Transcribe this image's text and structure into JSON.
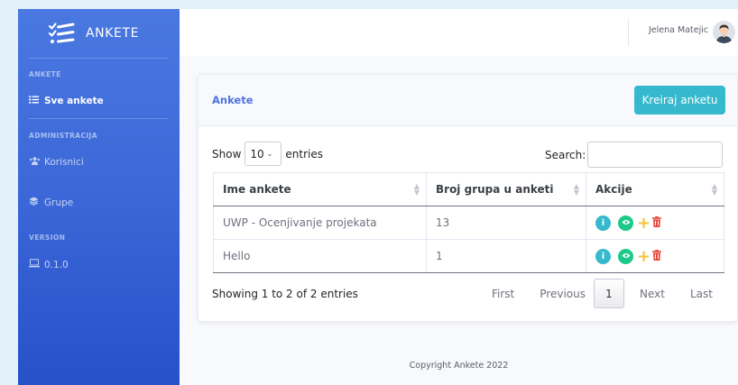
{
  "brand": {
    "name": "ANKETE",
    "icon": "list-check-icon"
  },
  "sidebar": {
    "sections": [
      {
        "heading": "ANKETE",
        "items": [
          {
            "label": "Sve ankete",
            "icon": "list-icon",
            "active": true
          }
        ]
      },
      {
        "heading": "ADMINISTRACIJA",
        "items": [
          {
            "label": "Korisnici",
            "icon": "users-icon"
          },
          {
            "label": "Grupe",
            "icon": "layers-icon"
          }
        ]
      },
      {
        "heading": "VERSION",
        "items": [
          {
            "label": "0.1.0",
            "icon": "laptop-icon"
          }
        ]
      }
    ]
  },
  "topbar": {
    "user_name": "Jelena Matejic"
  },
  "card": {
    "title": "Ankete",
    "create_button": "Kreiraj anketu",
    "show_label": "Show",
    "entries_value": "10",
    "entries_label": "entries",
    "search_label": "Search:",
    "search_value": ""
  },
  "table": {
    "columns": [
      "Ime ankete",
      "Broj grupa u anketi",
      "Akcije"
    ],
    "rows": [
      {
        "name": "UWP - Ocenjivanje projekata",
        "groups": "13"
      },
      {
        "name": "Hello",
        "groups": "1"
      }
    ]
  },
  "pagination": {
    "info": "Showing 1 to 2 of 2 entries",
    "first": "First",
    "previous": "Previous",
    "current": "1",
    "next": "Next",
    "last": "Last"
  },
  "footer": {
    "text": "Copyright Ankete 2022"
  },
  "colors": {
    "primary": "#4e73df",
    "info": "#36b9cc",
    "success": "#1cc88a",
    "warning": "#f6c23e",
    "danger": "#e74a3b"
  }
}
